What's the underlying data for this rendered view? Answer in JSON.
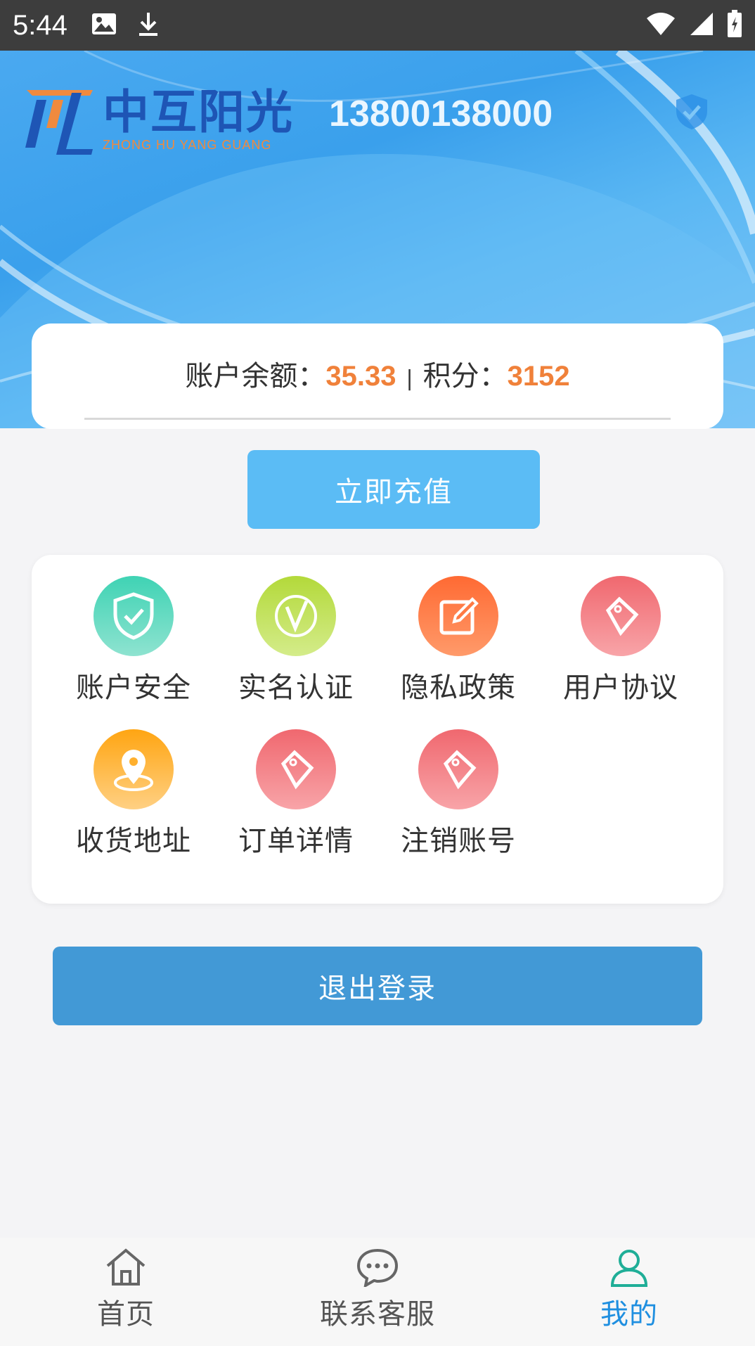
{
  "status_bar": {
    "time": "5:44",
    "icons": [
      "image-icon",
      "download-icon",
      "wifi-icon",
      "signal-icon",
      "battery-icon"
    ]
  },
  "header": {
    "logo_cn": "中互阳光",
    "logo_en": "ZHONG HU YANG GUANG",
    "phone": "13800138000",
    "badge_icon": "shield-check-icon"
  },
  "balance": {
    "balance_label": "账户余额：",
    "balance_value": "35.33",
    "separator": "|",
    "points_label": "积分：",
    "points_value": "3152"
  },
  "recharge": {
    "label": "立即充值"
  },
  "menu": {
    "items": [
      {
        "label": "账户安全",
        "icon": "shield-icon"
      },
      {
        "label": "实名认证",
        "icon": "verify-icon"
      },
      {
        "label": "隐私政策",
        "icon": "edit-icon"
      },
      {
        "label": "用户协议",
        "icon": "tag-icon"
      },
      {
        "label": "收货地址",
        "icon": "location-icon"
      },
      {
        "label": "订单详情",
        "icon": "tag-icon"
      },
      {
        "label": "注销账号",
        "icon": "tag-icon"
      }
    ]
  },
  "logout": {
    "label": "退出登录"
  },
  "bottom_nav": {
    "items": [
      {
        "label": "首页",
        "icon": "home-icon",
        "active": false
      },
      {
        "label": "联系客服",
        "icon": "chat-icon",
        "active": false
      },
      {
        "label": "我的",
        "icon": "user-icon",
        "active": true
      }
    ]
  },
  "colors": {
    "accent_orange": "#f0813a",
    "recharge_blue": "#5bbcf5",
    "logout_blue": "#4299d6",
    "nav_active": "#1f8fe0"
  }
}
